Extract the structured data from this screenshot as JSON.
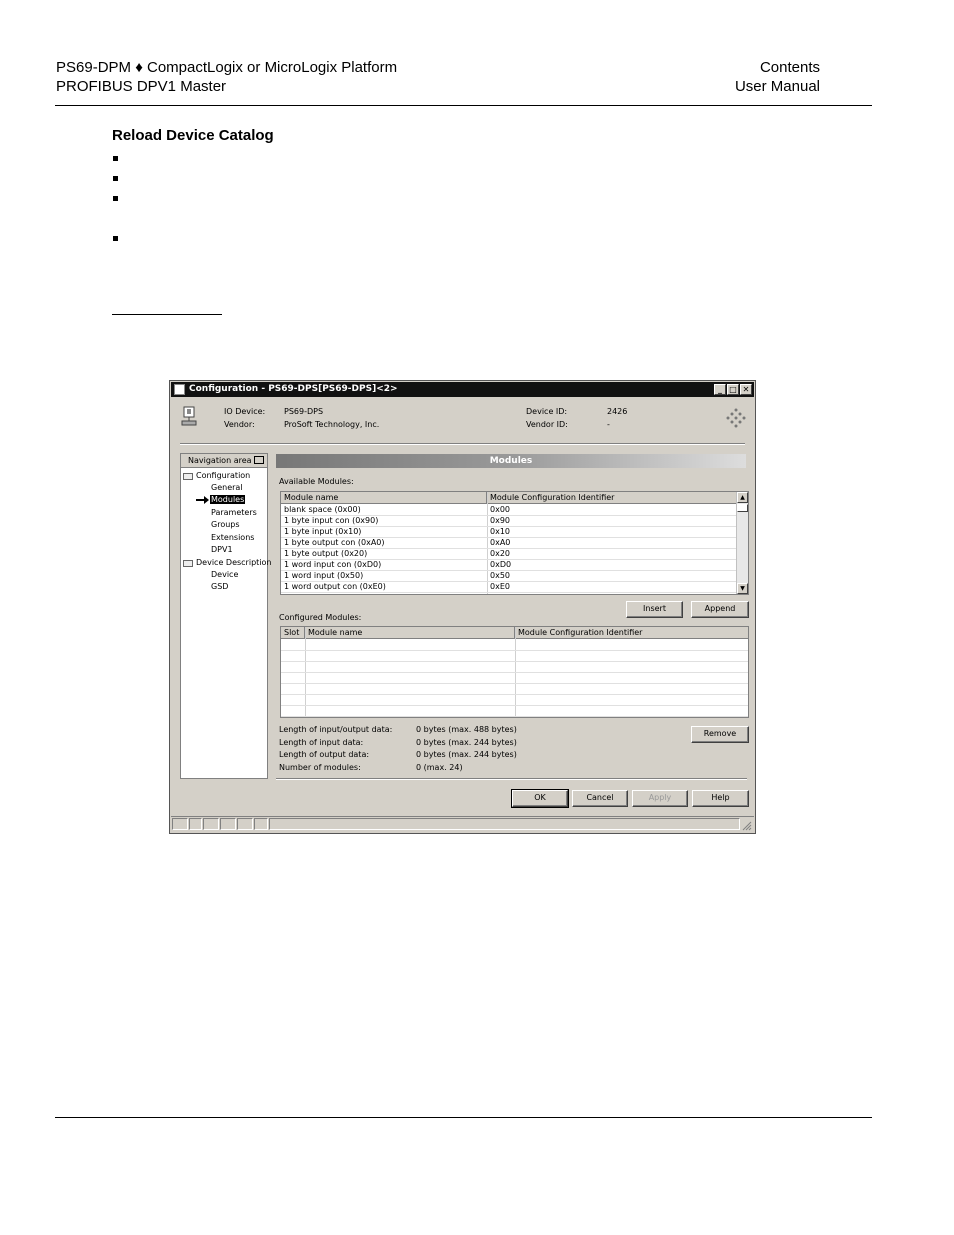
{
  "header": {
    "left_line1": "PS69-DPM ♦ CompactLogix or MicroLogix Platform",
    "left_line2": "PROFIBUS DPV1 Master",
    "right_line1": "Contents",
    "right_line2": "User Manual"
  },
  "section": {
    "title": "Reload Device Catalog"
  },
  "dialog": {
    "title": "Configuration - PS69-DPS[PS69-DPS]<2>",
    "title_buttons": [
      "_",
      "□",
      "✕"
    ],
    "io_device_label": "IO Device:",
    "io_device_value": "PS69-DPS",
    "vendor_label": "Vendor:",
    "vendor_value": "ProSoft Technology, Inc.",
    "device_id_label": "Device ID:",
    "device_id_value": "2426",
    "vendor_id_label": "Vendor ID:",
    "vendor_id_value": "-",
    "nav": {
      "header": "Navigation area",
      "configuration": "Configuration",
      "items": [
        "General",
        "Modules",
        "Parameters",
        "Groups",
        "Extensions",
        "DPV1"
      ],
      "selected": "Modules",
      "device_description": "Device Description",
      "dd_items": [
        "Device",
        "GSD"
      ]
    },
    "panel_title": "Modules",
    "available_label": "Available Modules:",
    "available_headers": [
      "Module name",
      "Module Configuration Identifier"
    ],
    "available_rows": [
      [
        "blank space (0x00)",
        "0x00"
      ],
      [
        "1  byte input con  (0x90)",
        "0x90"
      ],
      [
        "1  byte input      (0x10)",
        "0x10"
      ],
      [
        "1  byte output con (0xA0)",
        "0xA0"
      ],
      [
        "1  byte output     (0x20)",
        "0x20"
      ],
      [
        "1  word input con  (0xD0)",
        "0xD0"
      ],
      [
        "1  word input      (0x50)",
        "0x50"
      ],
      [
        "1  word output con (0xE0)",
        "0xE0"
      ]
    ],
    "insert_button": "Insert",
    "append_button": "Append",
    "configured_label": "Configured Modules:",
    "configured_headers": [
      "Slot",
      "Module name",
      "Module Configuration Identifier"
    ],
    "stats": [
      {
        "label": "Length of input/output data:",
        "value": "0 bytes (max. 488 bytes)"
      },
      {
        "label": "Length of input data:",
        "value": "0 bytes (max. 244 bytes)"
      },
      {
        "label": "Length of output data:",
        "value": "0 bytes (max. 244 bytes)"
      },
      {
        "label": "Number of modules:",
        "value": "0 (max. 24)"
      }
    ],
    "remove_button": "Remove",
    "ok_button": "OK",
    "cancel_button": "Cancel",
    "apply_button": "Apply",
    "help_button": "Help"
  }
}
